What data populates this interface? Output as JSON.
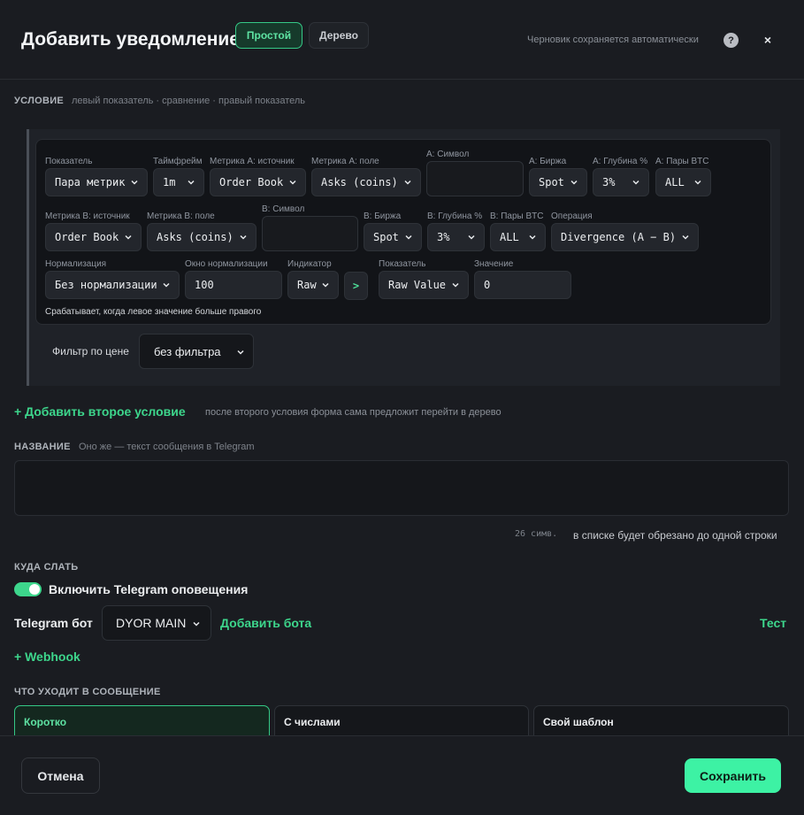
{
  "header": {
    "title": "Добавить уведомление",
    "mode_simple": "Простой",
    "mode_tree": "Дерево",
    "draft_note": "Черновик сохраняется автоматически",
    "help": "?",
    "close": "×"
  },
  "condition": {
    "label": "УСЛОВИЕ",
    "sub": "левый показатель · сравнение · правый показатель",
    "row1": [
      {
        "label": "Показатель",
        "value": "Пара метрик"
      },
      {
        "label": "Таймфрейм",
        "value": "1m"
      },
      {
        "label": "Метрика A: источник",
        "value": "Order Book"
      },
      {
        "label": "Метрика A: поле",
        "value": "Asks (coins)"
      },
      {
        "label": "A: Символ",
        "value": ""
      },
      {
        "label": "A: Биржа",
        "value": "Spot"
      },
      {
        "label": "A: Глубина %",
        "value": "3%"
      },
      {
        "label": "A: Пары BTC",
        "value": "ALL"
      }
    ],
    "row2": [
      {
        "label": "Метрика B: источник",
        "value": "Order Book"
      },
      {
        "label": "Метрика B: поле",
        "value": "Asks (coins)"
      },
      {
        "label": "B: Символ",
        "value": ""
      },
      {
        "label": "B: Биржа",
        "value": "Spot"
      },
      {
        "label": "B: Глубина %",
        "value": "3%"
      },
      {
        "label": "B: Пары BTC",
        "value": "ALL"
      },
      {
        "label": "Операция",
        "value": "Divergence (A − B)"
      }
    ],
    "row3": [
      {
        "label": "Нормализация",
        "value": "Без нормализации"
      },
      {
        "label": "Окно нормализации",
        "value": "100"
      },
      {
        "label": "Индикатор",
        "value": "Raw"
      },
      {
        "label": "Показатель",
        "value": "Raw Value"
      },
      {
        "label": "Значение",
        "value": "0"
      }
    ],
    "comparator": ">",
    "hint": "Срабатывает, когда левое значение больше правого",
    "price_filter_label": "Фильтр по цене",
    "price_filter_value": "без фильтра"
  },
  "add_condition": {
    "label": "+ Добавить второе условие",
    "sub": "после второго условия форма сама предложит перейти в дерево"
  },
  "name": {
    "label": "НАЗВАНИЕ",
    "sub": "Оно же — текст сообщения в Telegram",
    "value": "",
    "char_count": "26 симв.",
    "char_hint": "в списке будет обрезано до одной строки"
  },
  "destination": {
    "label": "КУДА СЛАТЬ",
    "telegram_toggle_label": "Включить Telegram оповещения",
    "bot_label": "Telegram бот",
    "bot_value": "DYOR MAIN",
    "add_bot": "Добавить бота",
    "test": "Тест",
    "webhook": "+ Webhook"
  },
  "message": {
    "label": "ЧТО УХОДИТ В СООБЩЕНИЕ",
    "cards": [
      "Коротко",
      "С числами",
      "Свой шаблон"
    ]
  },
  "footer": {
    "cancel": "Отмена",
    "save": "Сохранить"
  },
  "colors": {
    "accent": "#3dd68c",
    "save_bg": "#3df2a4",
    "background": "#1a1c21"
  }
}
